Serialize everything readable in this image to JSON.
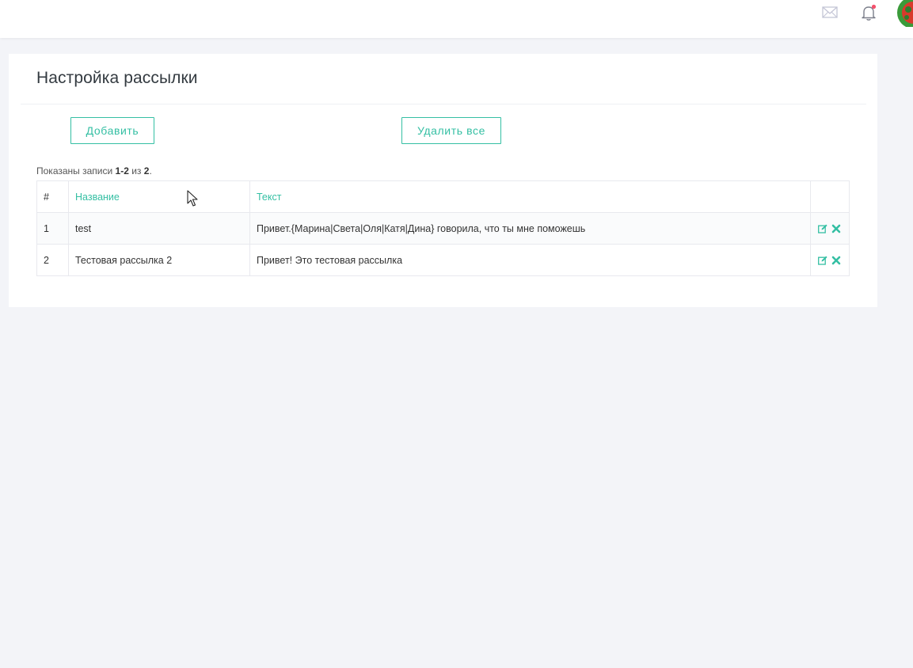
{
  "header": {
    "icons": [
      "mail-icon",
      "bell-icon",
      "user-avatar"
    ],
    "notification_dot_color": "#f4516c"
  },
  "panel": {
    "title": "Настройка рассылки",
    "buttons": {
      "add_label": "Добавить",
      "delete_all_label": "Удалить все"
    },
    "summary": {
      "prefix": "Показаны записи ",
      "range": "1-2",
      "of_word": " из ",
      "total": "2",
      "suffix": "."
    },
    "table": {
      "headers": {
        "num": "#",
        "name": "Название",
        "text": "Текст"
      },
      "rows": [
        {
          "num": "1",
          "name": "test",
          "text": "Привет.{Марина|Света|Оля|Катя|Дина} говорила, что ты мне поможешь"
        },
        {
          "num": "2",
          "name": "Тестовая рассылка 2",
          "text": "Привет! Это тестовая рассылка"
        }
      ],
      "row_actions": [
        "edit-icon",
        "delete-icon"
      ]
    }
  },
  "colors": {
    "accent": "#34bfa3",
    "background": "#f3f4f8"
  }
}
